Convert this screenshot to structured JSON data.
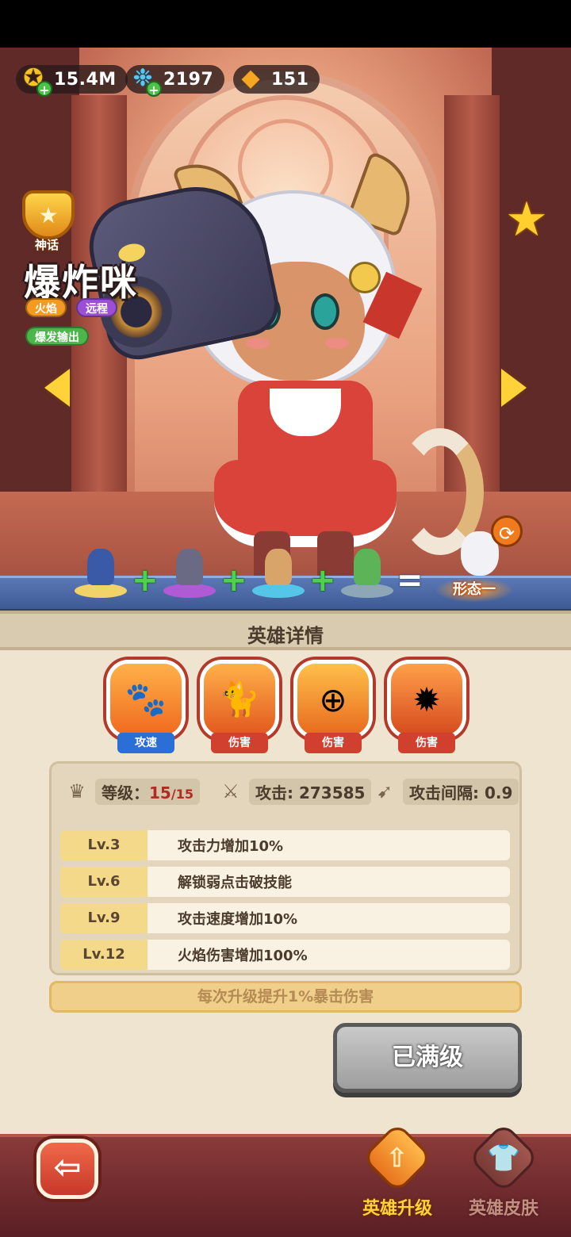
{
  "currency": {
    "gold": {
      "value": "15.4M",
      "icon": "gold-coin-icon"
    },
    "gems": {
      "value": "2197",
      "icon": "blue-gem-icon"
    },
    "crystals": {
      "value": "151",
      "icon": "orange-crystal-icon"
    }
  },
  "hero": {
    "rarity": "神话",
    "name": "爆炸咪",
    "tags": [
      "火焰",
      "远程",
      "爆发输出"
    ]
  },
  "formation": {
    "plus": "+",
    "equals": "=",
    "result_label": "形态一"
  },
  "panel": {
    "title": "英雄详情",
    "skills": [
      {
        "icon": "paw-attack-speed-icon",
        "label": "攻速"
      },
      {
        "icon": "black-cat-damage-icon",
        "label": "伤害"
      },
      {
        "icon": "crosshair-damage-icon",
        "label": "伤害"
      },
      {
        "icon": "gatling-cat-damage-icon",
        "label": "伤害"
      }
    ],
    "stats": {
      "level_label": "等级：",
      "level_current": "15",
      "level_max": "/15",
      "attack_label": "攻击: ",
      "attack_value": "273585",
      "interval_label": "攻击间隔: ",
      "interval_value": "0.9"
    },
    "upgrades": [
      {
        "level": "Lv.3",
        "desc": "攻击力增加10%"
      },
      {
        "level": "Lv.6",
        "desc": "解锁弱点击破技能"
      },
      {
        "level": "Lv.9",
        "desc": "攻击速度增加10%"
      },
      {
        "level": "Lv.12",
        "desc": "火焰伤害增加100%"
      }
    ],
    "tip": "每次升级提升1%暴击伤害",
    "maxed_button": "已满级"
  },
  "nav": {
    "upgrade": "英雄升级",
    "skin": "英雄皮肤"
  },
  "colors": {
    "accent_gold": "#ffd23a",
    "panel_bg": "#efe4cf",
    "level_red": "#b22a22"
  }
}
